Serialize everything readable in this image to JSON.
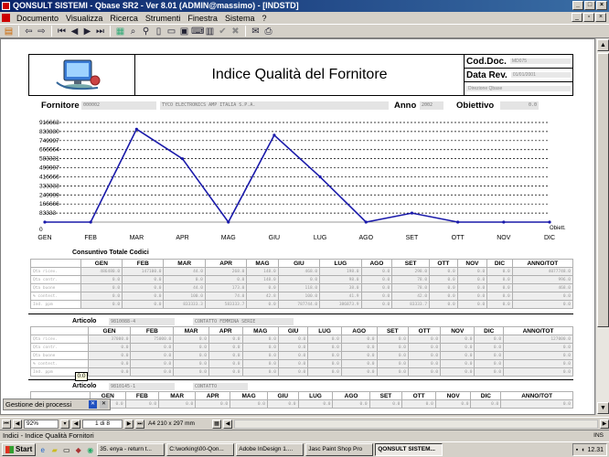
{
  "window": {
    "title": "QONSULT SISTEMI - Qbase SR2 - Ver 8.01 (ADMIN@massimo) - [INDSTD]"
  },
  "menu": {
    "items": [
      "Documento",
      "Visualizza",
      "Ricerca",
      "Strumenti",
      "Finestra",
      "Sistema",
      "?"
    ]
  },
  "toolbar": {
    "icons": [
      "new-doc-icon",
      "back-icon",
      "forward-icon",
      "first-record-icon",
      "prev-record-icon",
      "next-record-icon",
      "last-record-icon",
      "filter-icon",
      "search-icon",
      "zoom-icon",
      "page-icon",
      "doc-icon",
      "doc2-icon",
      "keyboard-icon",
      "grid-icon",
      "check-icon",
      "cancel-icon",
      "mail-icon",
      "print-icon"
    ]
  },
  "report": {
    "title": "Indice Qualità del Fornitore",
    "cod_doc_label": "Cod.Doc.",
    "cod_doc_value": "MD075",
    "data_rev_label": "Data Rev.",
    "data_rev_value": "01/01/2001",
    "third_value": "Direzione Qbase",
    "fornitore_label": "Fornitore",
    "fornitore_code": "000002",
    "fornitore_name": "TYCO ELECTRONICS AMP ITALIA S.P.A.",
    "anno_label": "Anno",
    "anno_value": "2002",
    "obiettivo_label": "Obiettivo",
    "obiettivo_value": "0.0"
  },
  "chart_data": {
    "type": "line",
    "categories": [
      "GEN",
      "FEB",
      "MAR",
      "APR",
      "MAG",
      "GIU",
      "LUG",
      "AGO",
      "SET",
      "OTT",
      "NOV",
      "DIC"
    ],
    "values": [
      0,
      0,
      855000,
      583000,
      0,
      800000,
      416000,
      0,
      83000,
      0,
      0,
      0
    ],
    "ytick_labels": [
      "916663",
      "833330",
      "749997",
      "666664",
      "583331",
      "499997",
      "416666",
      "333333",
      "249999",
      "166666",
      "83333"
    ],
    "ylim": [
      0,
      916663
    ],
    "zero_label": "0",
    "target_label": "Obiett.",
    "color": "#1a1aaa"
  },
  "summary": {
    "title": "Consuntivo Totale Codici",
    "headers": [
      "",
      "GEN",
      "FEB",
      "MAR",
      "APR",
      "MAG",
      "GIU",
      "LUG",
      "AGO",
      "SET",
      "OTT",
      "NOV",
      "DIC",
      "ANNO/TOT"
    ],
    "rows": [
      [
        "Qta ricev.",
        "486480.0",
        "147100.0",
        "44.0",
        "268.0",
        "148.0",
        "468.0",
        "198.0",
        "0.0",
        "298.0",
        "0.0",
        "0.0",
        "0.0",
        "4077748.0"
      ],
      [
        "Qta contr.",
        "0.0",
        "0.0",
        "0.0",
        "0.0",
        "148.0",
        "0.0",
        "98.0",
        "0.0",
        "78.0",
        "0.0",
        "0.0",
        "0.0",
        "996.0"
      ],
      [
        "Qta buone",
        "0.0",
        "0.0",
        "44.0",
        "173.0",
        "0.0",
        "118.0",
        "38.0",
        "0.0",
        "78.0",
        "0.0",
        "0.0",
        "0.0",
        "468.0"
      ],
      [
        "% contest.",
        "0.0",
        "0.0",
        "100.0",
        "74.0",
        "42.8",
        "100.0",
        "41.9",
        "0.0",
        "42.0",
        "0.0",
        "0.0",
        "0.0",
        "0.0"
      ],
      [
        "Ind. ppm",
        "0.0",
        "0.0",
        "833333.3",
        "583333.7",
        "0.0",
        "787744.0",
        "386873.9",
        "0.0",
        "83333.7",
        "0.0",
        "0.0",
        "0.0",
        "0.0"
      ]
    ]
  },
  "articolo1": {
    "label": "Articolo",
    "code": "9810088-4",
    "desc": "CONTATTO FEMMINA SERIE",
    "headers": [
      "",
      "GEN",
      "FEB",
      "MAR",
      "APR",
      "MAG",
      "GIU",
      "LUG",
      "AGO",
      "SET",
      "OTT",
      "NOV",
      "DIC",
      "ANNO/TOT"
    ],
    "rows": [
      [
        "Qta ricev.",
        "37000.0",
        "75000.0",
        "0.0",
        "0.0",
        "0.0",
        "0.0",
        "0.0",
        "0.0",
        "0.0",
        "0.0",
        "0.0",
        "0.0",
        "127000.0"
      ],
      [
        "Qta contr.",
        "0.0",
        "0.0",
        "0.0",
        "0.0",
        "0.0",
        "0.0",
        "0.0",
        "0.0",
        "0.0",
        "0.0",
        "0.0",
        "0.0",
        "0.0"
      ],
      [
        "Qta buone",
        "0.0",
        "0.0",
        "0.0",
        "0.0",
        "0.0",
        "0.0",
        "0.0",
        "0.0",
        "0.0",
        "0.0",
        "0.0",
        "0.0",
        "0.0"
      ],
      [
        "% contest.",
        "0.0",
        "0.0",
        "0.0",
        "0.0",
        "0.0",
        "0.0",
        "0.0",
        "0.0",
        "0.0",
        "0.0",
        "0.0",
        "0.0",
        "0.0"
      ],
      [
        "Ind. ppm",
        "0.0",
        "0.0",
        "0.0",
        "0.0",
        "0.0",
        "0.0",
        "0.0",
        "0.0",
        "0.0",
        "0.0",
        "0.0",
        "0.0",
        "0.0"
      ]
    ],
    "tooltip": "0.0"
  },
  "articolo2": {
    "label": "Articolo",
    "code": "9810145-1",
    "desc": "CONTATTO",
    "headers": [
      "",
      "GEN",
      "FEB",
      "MAR",
      "APR",
      "MAG",
      "GIU",
      "LUG",
      "AGO",
      "SET",
      "OTT",
      "NOV",
      "DIC",
      "ANNO/TOT"
    ],
    "rows": [
      [
        "Qta ricev.",
        "0.0",
        "0.0",
        "0.0",
        "0.0",
        "0.0",
        "0.0",
        "0.0",
        "0.0",
        "0.0",
        "0.0",
        "0.0",
        "0.0",
        "0.0"
      ]
    ]
  },
  "docked_panel": {
    "label": "Gestione dei processi"
  },
  "navbar": {
    "zoom": "92%",
    "page": "1 di 8",
    "paper": "A4 210 x 297 mm"
  },
  "statusbar": {
    "text": "Indici - Indice Qualità Fornitori",
    "ins": "INS"
  },
  "taskbar": {
    "start": "Start",
    "tasks": [
      "35. enya - return t...",
      "C:\\working\\00-Qon...",
      "Adobe InDesign 1....",
      "Jasc Paint Shop Pro",
      "QONSULT SISTEM..."
    ],
    "clock": "12.31"
  }
}
